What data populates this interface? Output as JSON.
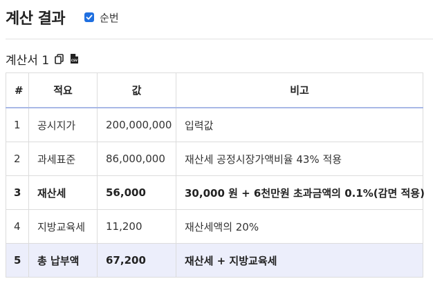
{
  "header": {
    "title": "계산 결과",
    "checkbox_label": "순번",
    "checkbox_checked": true
  },
  "section": {
    "title": "계산서 1",
    "copy_icon": "copy-icon",
    "csv_icon": "csv-file-icon",
    "csv_icon_text": "CSV"
  },
  "table": {
    "columns": [
      "#",
      "적요",
      "값",
      "비고"
    ],
    "rows": [
      {
        "no": "1",
        "item": "공시지가",
        "value": "200,000,000",
        "note": "입력값",
        "bold": false,
        "highlight": false
      },
      {
        "no": "2",
        "item": "과세표준",
        "value": "86,000,000",
        "note": "재산세 공정시장가액비율 43% 적용",
        "bold": false,
        "highlight": false
      },
      {
        "no": "3",
        "item": "재산세",
        "value": "56,000",
        "note": "30,000 원 + 6천만원 초과금액의 0.1%(감면 적용)",
        "bold": true,
        "highlight": false
      },
      {
        "no": "4",
        "item": "지방교육세",
        "value": "11,200",
        "note": "재산세액의 20%",
        "bold": false,
        "highlight": false
      },
      {
        "no": "5",
        "item": "총 납부액",
        "value": "67,200",
        "note": "재산세 + 지방교육세",
        "bold": true,
        "highlight": true
      }
    ]
  },
  "colors": {
    "accent": "#1f6fe0",
    "highlight_row": "#eceefb",
    "header_underline": "#a8b8e6"
  }
}
